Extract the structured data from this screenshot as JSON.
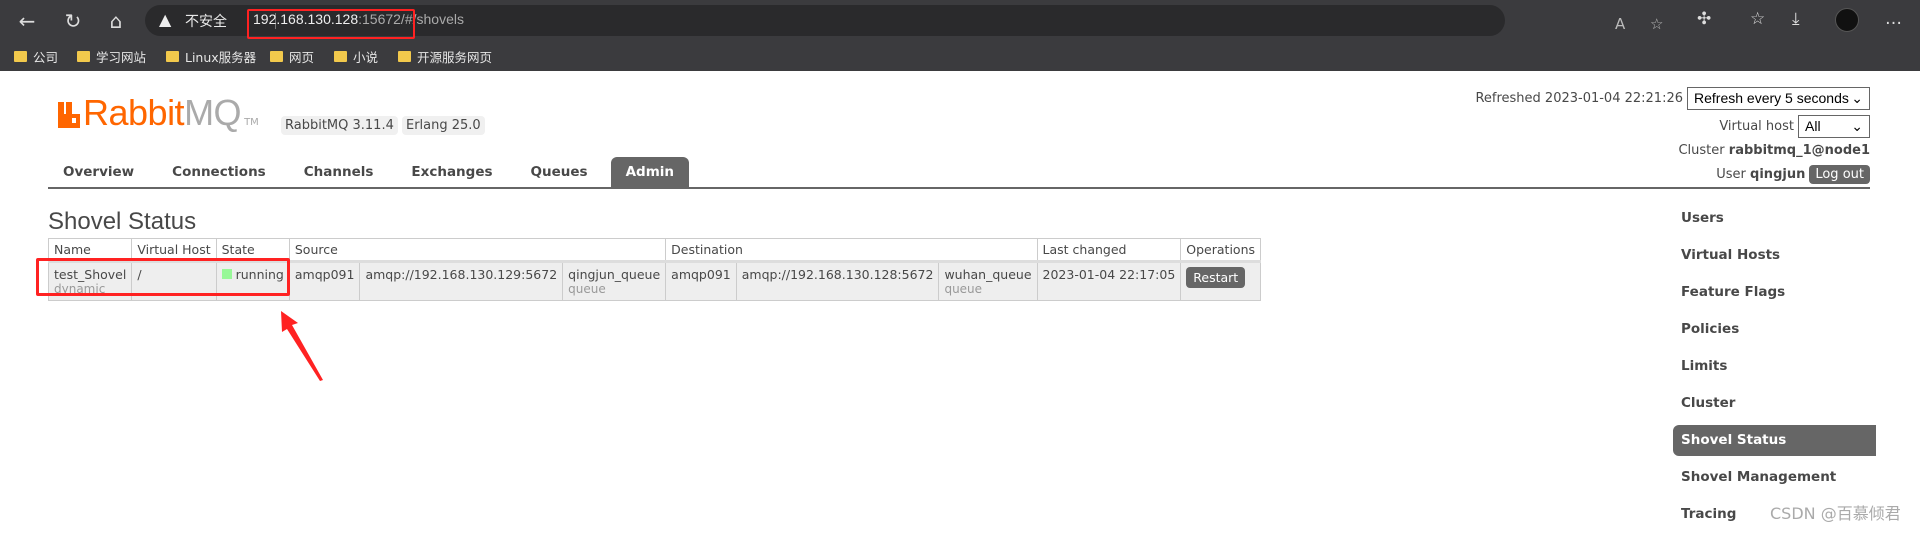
{
  "browser": {
    "insecure_label": "不安全",
    "url_host": "192.168.130.128",
    "url_rest": ":15672/#/shovels",
    "bookmarks": [
      "公司",
      "学习网站",
      "Linux服务器",
      "网页",
      "小说",
      "开源服务网页"
    ]
  },
  "header": {
    "logo_brand": "Rabbit",
    "logo_mq": "MQ",
    "logo_tm": "TM",
    "version": "RabbitMQ 3.11.4",
    "erlang": "Erlang 25.0",
    "refreshed_label": "Refreshed 2023-01-04 22:21:26",
    "refresh_select": "Refresh every 5 seconds",
    "vhost_label": "Virtual host",
    "vhost_select": "All",
    "cluster_label": "Cluster",
    "cluster_name": "rabbitmq_1@node1",
    "user_label": "User",
    "user_name": "qingjun",
    "logout": "Log out"
  },
  "tabs": [
    {
      "label": "Overview"
    },
    {
      "label": "Connections"
    },
    {
      "label": "Channels"
    },
    {
      "label": "Exchanges"
    },
    {
      "label": "Queues"
    },
    {
      "label": "Admin",
      "active": true
    }
  ],
  "page_title": "Shovel Status",
  "table": {
    "headers": [
      "Name",
      "Virtual Host",
      "State",
      "Source",
      "Destination",
      "Last changed",
      "Operations"
    ],
    "rows": [
      {
        "name": "test_Shovel",
        "type": "dynamic",
        "vhost": "/",
        "state": "running",
        "src_proto": "amqp091",
        "src_uri": "amqp://192.168.130.129:5672",
        "src_queue": "qingjun_queue",
        "src_kind": "queue",
        "dst_proto": "amqp091",
        "dst_uri": "amqp://192.168.130.128:5672",
        "dst_queue": "wuhan_queue",
        "dst_kind": "queue",
        "last_changed": "2023-01-04 22:17:05",
        "op": "Restart"
      }
    ]
  },
  "sidebar": {
    "items": [
      {
        "label": "Users"
      },
      {
        "label": "Virtual Hosts"
      },
      {
        "label": "Feature Flags"
      },
      {
        "label": "Policies"
      },
      {
        "label": "Limits"
      },
      {
        "label": "Cluster"
      },
      {
        "label": "Shovel Status",
        "active": true
      },
      {
        "label": "Shovel Management"
      },
      {
        "label": "Tracing"
      }
    ]
  },
  "watermark": "CSDN @百慕倾君",
  "colors": {
    "brand": "#ff6600",
    "active_tab": "#666666",
    "running": "#98f898",
    "annotation": "#ff2222"
  }
}
